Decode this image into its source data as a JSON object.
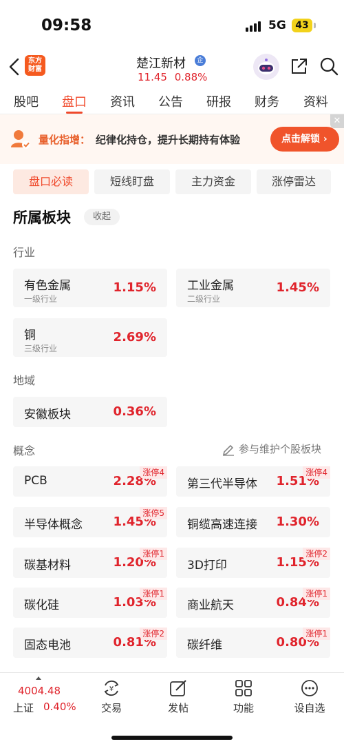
{
  "status_bar": {
    "time": "09:58",
    "network": "5G",
    "battery": "43"
  },
  "header": {
    "logo_line1": "东方",
    "logo_line2": "财富",
    "stock_name": "楚江新材",
    "cert_badge": "企",
    "price": "11.45",
    "change_pct": "0.88%"
  },
  "tabs": [
    "股吧",
    "盘口",
    "资讯",
    "公告",
    "研报",
    "财务",
    "资料"
  ],
  "active_tab": "盘口",
  "banner": {
    "title": "量化指增：",
    "text": "纪律化持仓，提升长期持有体验",
    "button": "点击解锁 ›",
    "close": "✕"
  },
  "subtabs": [
    "盘口必读",
    "短线盯盘",
    "主力资金",
    "涨停雷达"
  ],
  "section": {
    "title": "所属板块",
    "collapse": "收起",
    "industry_label": "行业",
    "region_label": "地域",
    "concept_label": "概念",
    "maintain": "参与维护个股板块"
  },
  "industry": [
    {
      "name": "有色金属",
      "level": "一级行业",
      "pct": "1.15%"
    },
    {
      "name": "工业金属",
      "level": "二级行业",
      "pct": "1.45%"
    },
    {
      "name": "铜",
      "level": "三级行业",
      "pct": "2.69%"
    }
  ],
  "region": [
    {
      "name": "安徽板块",
      "pct": "0.36%"
    }
  ],
  "concepts": [
    {
      "name": "PCB",
      "pct": "2.28%",
      "tag": "涨停4"
    },
    {
      "name": "第三代半导体",
      "pct": "1.51%",
      "tag": "涨停4"
    },
    {
      "name": "半导体概念",
      "pct": "1.45%",
      "tag": "涨停5"
    },
    {
      "name": "铜缆高速连接",
      "pct": "1.30%",
      "tag": ""
    },
    {
      "name": "碳基材料",
      "pct": "1.20%",
      "tag": "涨停1"
    },
    {
      "name": "3D打印",
      "pct": "1.15%",
      "tag": "涨停2"
    },
    {
      "name": "碳化硅",
      "pct": "1.03%",
      "tag": "涨停1"
    },
    {
      "name": "商业航天",
      "pct": "0.84%",
      "tag": "涨停1"
    },
    {
      "name": "固态电池",
      "pct": "0.81%",
      "tag": "涨停2"
    },
    {
      "name": "碳纤维",
      "pct": "0.80%",
      "tag": "涨停1"
    }
  ],
  "bottom_bar": {
    "index_value": "4004.48",
    "index_name": "上证",
    "index_pct": "0.40%",
    "nav": [
      "交易",
      "发帖",
      "功能",
      "设自选"
    ]
  },
  "colors": {
    "accent": "#f0492b",
    "up": "#e0242c"
  }
}
